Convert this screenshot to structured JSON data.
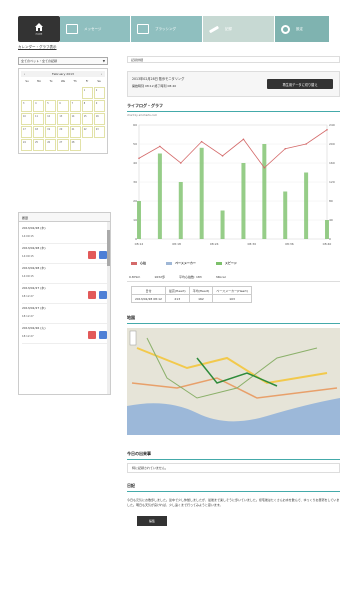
{
  "nav": {
    "home_label": "HOME",
    "tabs": [
      {
        "label": "メッセージ"
      },
      {
        "label": "ブラッシング"
      },
      {
        "label": "記録"
      },
      {
        "label": "設定"
      }
    ]
  },
  "sidebar": {
    "title": "カレンダー・グラフ表示",
    "select_value": "全てのペット・全ての記録",
    "calendar": {
      "month_label": "February 2013",
      "prev": "‹",
      "next": "›",
      "dow": [
        "Su",
        "Mo",
        "Tu",
        "We",
        "Th",
        "Fr",
        "Sa"
      ]
    }
  },
  "history": {
    "title": "履歴",
    "items": [
      {
        "date": "2013/02/28 (木)",
        "sub": "14:09:15"
      },
      {
        "date": "2013/02/28 (木)",
        "sub": "14:09:15"
      },
      {
        "date": "2013/02/28 (木)",
        "sub": "14:09:15"
      },
      {
        "date": "2013/02/27 (水)",
        "sub": "18:12:27"
      },
      {
        "date": "2013/02/27 (水)",
        "sub": "18:12:27"
      },
      {
        "date": "2013/02/26 (火)",
        "sub": "18:12:27"
      }
    ]
  },
  "main": {
    "breadcrumb": "記録詳細",
    "info_line1": "2013年02月28日  散歩モニタリング",
    "info_line2": "開始時刻 08:12  終了時刻 08:40",
    "info_button": "再生用データに切り替え",
    "graph_title": "ライフログ・グラフ",
    "chart_caption": "chart by amcharts.com",
    "legend": [
      {
        "label": "心拍",
        "color": "#d46a6a"
      },
      {
        "label": "ペースメーカー",
        "color": "#9fb7d6"
      },
      {
        "label": "スピード",
        "color": "#7cc06a"
      }
    ],
    "stats_labels": [
      "距離",
      "歩数",
      "平均速度",
      "消費カロリー"
    ],
    "stats_values": [
      "0.87km",
      "1632歩",
      "平均心拍数: 183",
      "34kcal"
    ],
    "table_head": [
      "日付",
      "最高(Heart)",
      "平均(Heart)",
      "ペースメーカー(Heart)"
    ],
    "table_row": [
      "2013/02/28 08:12",
      "213",
      "162",
      "103"
    ],
    "map_title": "地図",
    "events_title": "今日の出来事",
    "events_text": "特に記録されていません。",
    "memo_title": "日記",
    "memo_text": "今日も元気にお散歩しました。途中で少し休憩しましたが、最後まで楽しそうに歩いていました。帰宅後はたくさんお水を飲んで、ゆっくりお昼寝をしていました。明日も天気が良ければ、少し遠くまで行ってみようと思います。",
    "edit_button": "編集"
  },
  "chart_data": {
    "type": "line",
    "x": [
      "08:12",
      "08:15",
      "08:18",
      "08:21",
      "08:24",
      "08:27",
      "08:30",
      "08:33",
      "08:36",
      "08:40"
    ],
    "x_tick_labels": [
      "08:12",
      "08:18",
      "08:24",
      "08:30",
      "08:36",
      "08:40"
    ],
    "y_left_ticks": [
      0,
      10,
      20,
      30,
      40,
      50,
      60
    ],
    "y_right_ticks": [
      0,
      40,
      80,
      120,
      160,
      200,
      240
    ],
    "series": [
      {
        "name": "心拍",
        "color": "#d46a6a",
        "values": [
          170,
          195,
          160,
          205,
          175,
          210,
          150,
          190,
          200,
          230
        ]
      },
      {
        "name": "スピード",
        "color": "#7cc06a",
        "values": [
          20,
          45,
          30,
          48,
          15,
          40,
          50,
          25,
          35,
          10
        ]
      }
    ]
  }
}
